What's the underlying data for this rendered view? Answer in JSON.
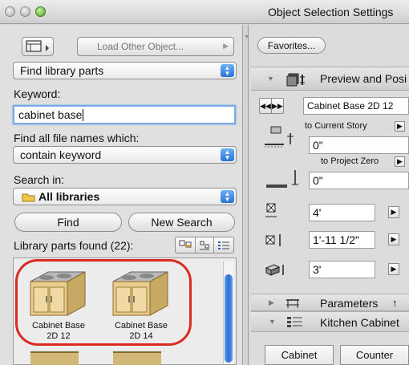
{
  "window": {
    "title": "Object Selection Settings"
  },
  "left": {
    "load_other_object": "Load Other Object...",
    "mode_select": "Find library parts",
    "keyword_label": "Keyword:",
    "keyword_value": "cabinet base",
    "find_names_label": "Find all file names which:",
    "condition_select": "contain keyword",
    "search_in_label": "Search in:",
    "search_in_select": "All libraries",
    "find_button": "Find",
    "new_search_button": "New Search",
    "found_label": "Library parts found (22):",
    "results": [
      {
        "name_line1": "Cabinet Base",
        "name_line2": "2D 12"
      },
      {
        "name_line1": "Cabinet Base",
        "name_line2": "2D 14"
      }
    ]
  },
  "right": {
    "favorites_button": "Favorites...",
    "preview_header": "Preview and Posi",
    "object_name": "Cabinet Base 2D 12",
    "to_current_story": "to Current Story",
    "elevation_value": "0\"",
    "to_project_zero": "to Project Zero",
    "project_zero_value": "0\"",
    "width_value": "4'",
    "depth_value": "1'-11 1/2\"",
    "height_value": "3'",
    "parameters_header": "Parameters",
    "kitchen_header": "Kitchen Cabinet",
    "tabs": [
      "Cabinet",
      "Counter"
    ]
  },
  "colors": {
    "accent_blue": "#2a73d6",
    "highlight_red": "#d92b22"
  }
}
